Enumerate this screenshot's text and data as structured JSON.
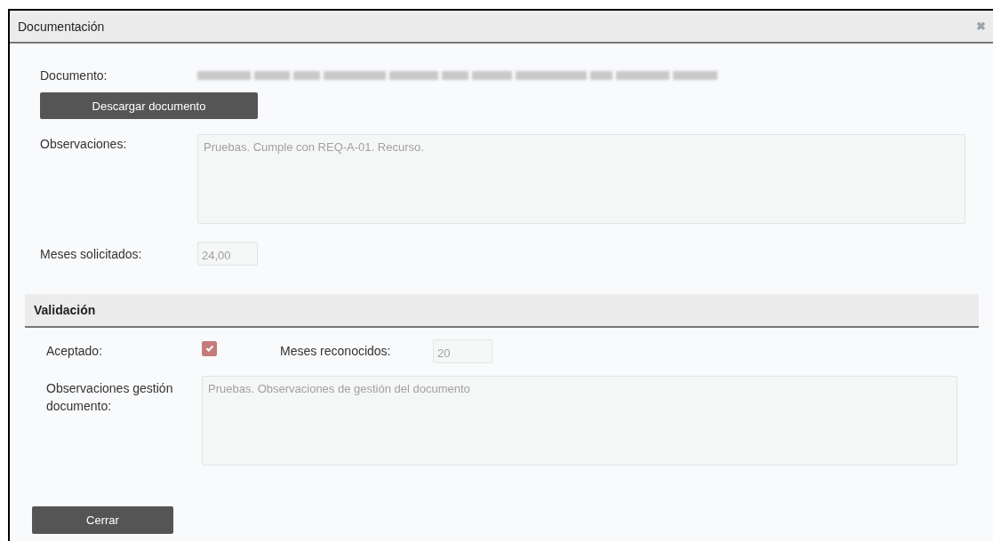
{
  "dialog": {
    "title": "Documentación",
    "close": "✖"
  },
  "document": {
    "label": "Documento:",
    "download_button": "Descargar documento"
  },
  "observations": {
    "label": "Observaciones:",
    "value": "Pruebas. Cumple con REQ-A-01. Recurso."
  },
  "requested_months": {
    "label": "Meses solicitados:",
    "value": "24,00"
  },
  "validation": {
    "title": "Validación",
    "accepted": {
      "label": "Aceptado:",
      "checked": true
    },
    "recognized_months": {
      "label": "Meses reconocidos:",
      "value": "20"
    },
    "management_observations": {
      "label": "Observaciones gestión documento:",
      "value": "Pruebas. Observaciones de gestión del documento"
    }
  },
  "buttons": [
    "Cerrar"
  ]
}
